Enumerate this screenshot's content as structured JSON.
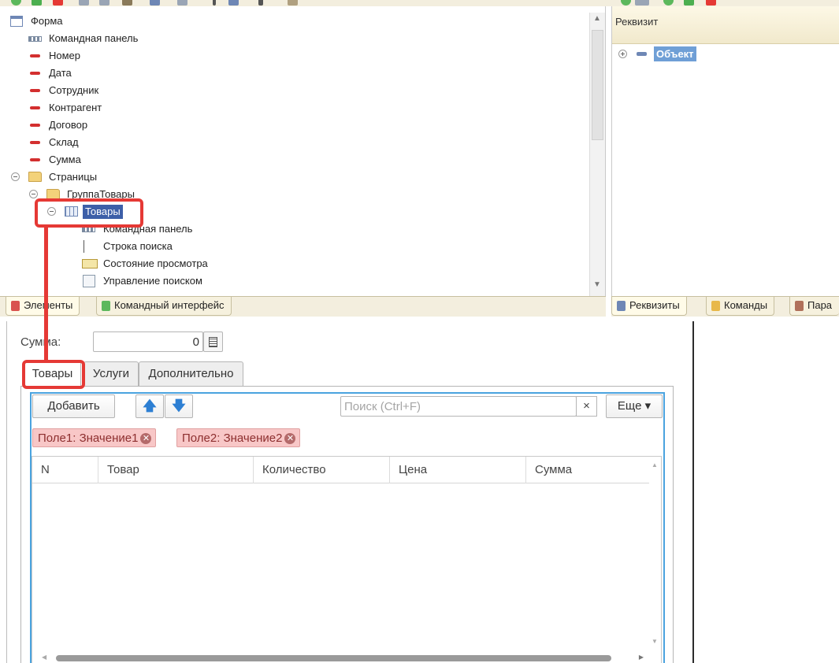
{
  "tree": {
    "items": [
      {
        "label": "Форма",
        "icon": "form-icon"
      },
      {
        "label": "Командная панель",
        "icon": "command-bar-icon"
      },
      {
        "label": "Номер",
        "icon": "field-icon"
      },
      {
        "label": "Дата",
        "icon": "field-icon"
      },
      {
        "label": "Сотрудник",
        "icon": "field-icon"
      },
      {
        "label": "Контрагент",
        "icon": "field-icon"
      },
      {
        "label": "Договор",
        "icon": "field-icon"
      },
      {
        "label": "Склад",
        "icon": "field-icon"
      },
      {
        "label": "Сумма",
        "icon": "field-icon"
      },
      {
        "label": "Страницы",
        "icon": "folder-icon"
      },
      {
        "label": "ГруппаТовары",
        "icon": "folder-icon"
      },
      {
        "label": "Товары",
        "icon": "table-icon",
        "selected": true
      },
      {
        "label": "Командная панель",
        "icon": "command-bar-icon"
      },
      {
        "label": "Строка поиска",
        "icon": "search-string-icon"
      },
      {
        "label": "Состояние просмотра",
        "icon": "view-state-icon"
      },
      {
        "label": "Управление поиском",
        "icon": "search-control-icon"
      }
    ],
    "tabs": {
      "elements": "Элементы",
      "command_interface": "Командный интерфейс"
    }
  },
  "right_panel": {
    "header": "Реквизит",
    "object_label": "Объект",
    "tabs": {
      "attributes": "Реквизиты",
      "commands": "Команды",
      "parameters": "Пара"
    }
  },
  "form": {
    "summa_label": "Сумма:",
    "summa_value": "0",
    "tabs": {
      "goods": "Товары",
      "services": "Услуги",
      "additional": "Дополнительно"
    },
    "toolbar": {
      "add_label": "Добавить",
      "up_arrow": "🡅",
      "down_arrow": "🡇",
      "search_placeholder": "Поиск (Ctrl+F)",
      "clear": "×",
      "more_label": "Еще ▾"
    },
    "filters": [
      {
        "label": "Поле1: Значение1"
      },
      {
        "label": "Поле2: Значение2"
      }
    ],
    "columns": [
      "N",
      "Товар",
      "Количество",
      "Цена",
      "Сумма"
    ]
  },
  "colors": {
    "highlight": "#e53935",
    "selection": "#3d5fa8",
    "frame": "#4aa3df"
  }
}
